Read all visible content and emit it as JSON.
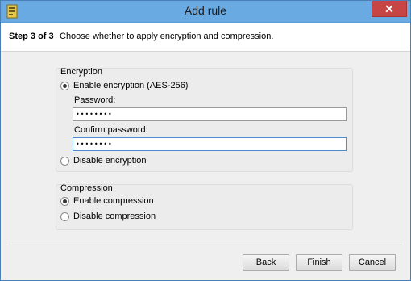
{
  "window": {
    "title": "Add rule",
    "close_glyph": "✕",
    "icon": "app-icon"
  },
  "header": {
    "step": "Step 3 of 3",
    "description": "Choose whether to apply encryption and compression."
  },
  "encryption": {
    "title": "Encryption",
    "enable_label": "Enable encryption (AES-256)",
    "enable_checked": true,
    "password_label": "Password:",
    "password_value": "••••••••",
    "confirm_label": "Confirm password:",
    "confirm_value": "••••••••",
    "disable_label": "Disable encryption",
    "disable_checked": false
  },
  "compression": {
    "title": "Compression",
    "enable_label": "Enable compression",
    "enable_checked": true,
    "disable_label": "Disable compression",
    "disable_checked": false
  },
  "buttons": {
    "back": "Back",
    "finish": "Finish",
    "cancel": "Cancel"
  },
  "colors": {
    "titlebar": "#6aaae3",
    "close": "#c74544",
    "focus": "#4e8bd1"
  }
}
